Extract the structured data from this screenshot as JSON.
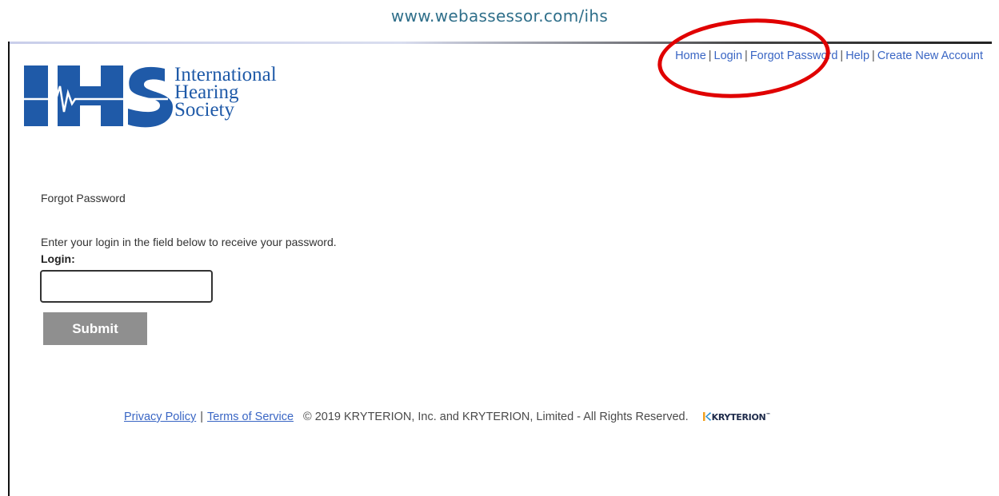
{
  "caption": {
    "url": "www.webassessor.com/ihs"
  },
  "nav": {
    "items": [
      {
        "label": "Home"
      },
      {
        "label": "Login"
      },
      {
        "label": "Forgot Password"
      },
      {
        "label": "Help"
      },
      {
        "label": "Create New Account"
      }
    ],
    "separator": "|"
  },
  "logo": {
    "mark": "IHS",
    "line1": "International",
    "line2": "Hearing",
    "line3": "Society",
    "color": "#1f5aa8"
  },
  "form": {
    "heading": "Forgot Password",
    "instructions": "Enter your login in the field below to receive your password.",
    "login_label": "Login:",
    "login_value": "",
    "submit_label": "Submit"
  },
  "footer": {
    "privacy": "Privacy Policy",
    "terms": "Terms of Service",
    "separator": "|",
    "copyright": "© 2019  KRYTERION, Inc. and KRYTERION, Limited - All Rights Reserved.",
    "brand": "KRYTERION",
    "brand_mark": "™"
  },
  "annotation": {
    "color": "#e00000",
    "shape": "ellipse"
  }
}
